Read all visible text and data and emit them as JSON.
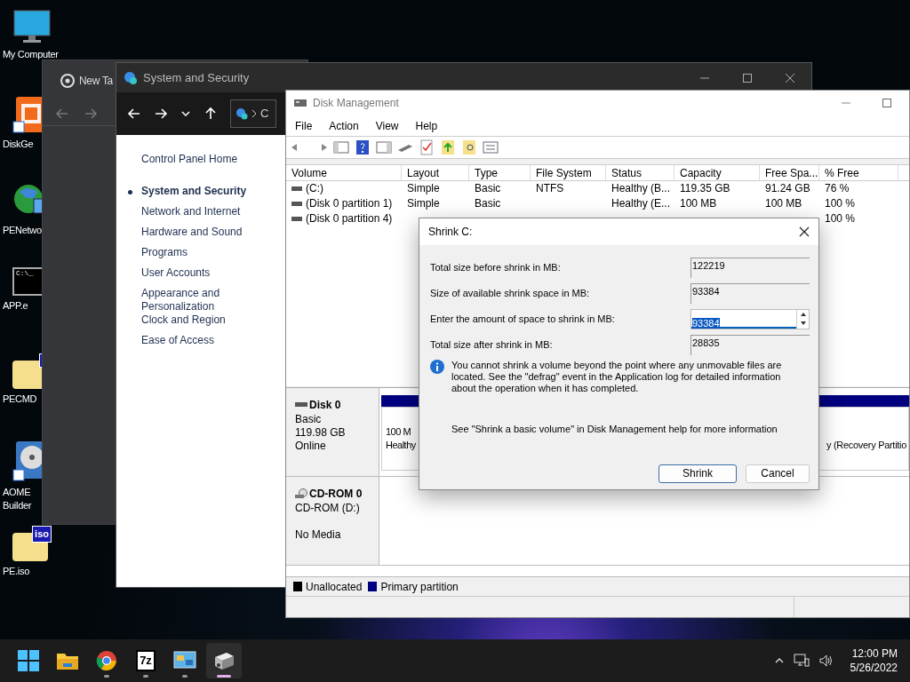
{
  "desktop_icons": [
    {
      "kind": "monitor",
      "lines": [
        "My Computer"
      ]
    },
    {
      "kind": "app",
      "lines": [
        "DiskGe"
      ],
      "shortcut": true
    },
    {
      "kind": "globe",
      "lines": [
        "PENetwo"
      ]
    },
    {
      "kind": "terminal",
      "badge": "C:\\_",
      "lines": [
        "APP.e"
      ]
    },
    {
      "kind": "folder",
      "lines": [
        "PECMD"
      ]
    },
    {
      "kind": "disc",
      "lines": [
        "AOME",
        "Builder"
      ],
      "shortcut": true
    },
    {
      "kind": "folder",
      "badge": "iso",
      "lines": [
        "PE.iso"
      ]
    }
  ],
  "browser_window": {
    "tab_title": "New Ta"
  },
  "control_panel": {
    "title": "System and Security",
    "address": "C",
    "home": "Control Panel Home",
    "nav": [
      {
        "label": "System and Security",
        "selected": true
      },
      {
        "label": "Network and Internet",
        "selected": false
      },
      {
        "label": "Hardware and Sound",
        "selected": false
      },
      {
        "label": "Programs",
        "selected": false
      },
      {
        "label": "User Accounts",
        "selected": false
      },
      {
        "label": "Appearance and Personalization",
        "selected": false
      },
      {
        "label": "Clock and Region",
        "selected": false
      },
      {
        "label": "Ease of Access",
        "selected": false
      }
    ]
  },
  "disk_management": {
    "title": "Disk Management",
    "menu": [
      "File",
      "Action",
      "View",
      "Help"
    ],
    "columns": [
      "Volume",
      "Layout",
      "Type",
      "File System",
      "Status",
      "Capacity",
      "Free Spa...",
      "% Free"
    ],
    "rows": [
      [
        "(C:)",
        "Simple",
        "Basic",
        "NTFS",
        "Healthy (B...",
        "119.35 GB",
        "91.24 GB",
        "76 %"
      ],
      [
        "(Disk 0 partition 1)",
        "Simple",
        "Basic",
        "",
        "Healthy (E...",
        "100 MB",
        "100 MB",
        "100 %"
      ],
      [
        "(Disk 0 partition 4)",
        "",
        "",
        "",
        "",
        "",
        "",
        "100 %"
      ]
    ],
    "disks": [
      {
        "kind": "disk",
        "name": "Disk 0",
        "lines": [
          "Basic",
          "119.98 GB",
          "Online"
        ],
        "left_partition": [
          "100 M",
          "Healthy"
        ],
        "right_partition": "y (Recovery Partitio"
      },
      {
        "kind": "cdrom",
        "name": "CD-ROM 0",
        "lines": [
          "CD-ROM (D:)",
          "No Media"
        ]
      }
    ],
    "legend": [
      {
        "label": "Unallocated",
        "color": "#000000"
      },
      {
        "label": "Primary partition",
        "color": "#000080"
      }
    ]
  },
  "dialog": {
    "title": "Shrink C:",
    "fields": [
      {
        "kind": "readonly",
        "label": "Total size before shrink in MB:",
        "value": "122219"
      },
      {
        "kind": "readonly",
        "label": "Size of available shrink space in MB:",
        "value": "93384"
      },
      {
        "kind": "spin",
        "label": "Enter the amount of space to shrink in MB:",
        "value": "93384",
        "text_selected": true
      },
      {
        "kind": "readonly",
        "label": "Total size after shrink in MB:",
        "value": "28835"
      }
    ],
    "info": "You cannot shrink a volume beyond the point where any unmovable files are located. See the \"defrag\" event in the Application log for detailed information about the operation when it has completed.",
    "help": "See \"Shrink a basic volume\" in Disk Management help for more information",
    "buttons": [
      {
        "label": "Shrink",
        "default": true
      },
      {
        "label": "Cancel",
        "default": false
      }
    ]
  },
  "taskbar": {
    "apps": [
      {
        "kind": "start",
        "running": false,
        "selected": false
      },
      {
        "kind": "explorer",
        "running": false,
        "selected": false
      },
      {
        "kind": "chrome",
        "running": true,
        "selected": false
      },
      {
        "kind": "sevenzip",
        "badge": "7z",
        "running": true,
        "selected": false
      },
      {
        "kind": "control",
        "running": true,
        "selected": false
      },
      {
        "kind": "diskmgmt",
        "running": true,
        "selected": true
      }
    ],
    "time": "12:00 PM",
    "date": "5/26/2022"
  }
}
